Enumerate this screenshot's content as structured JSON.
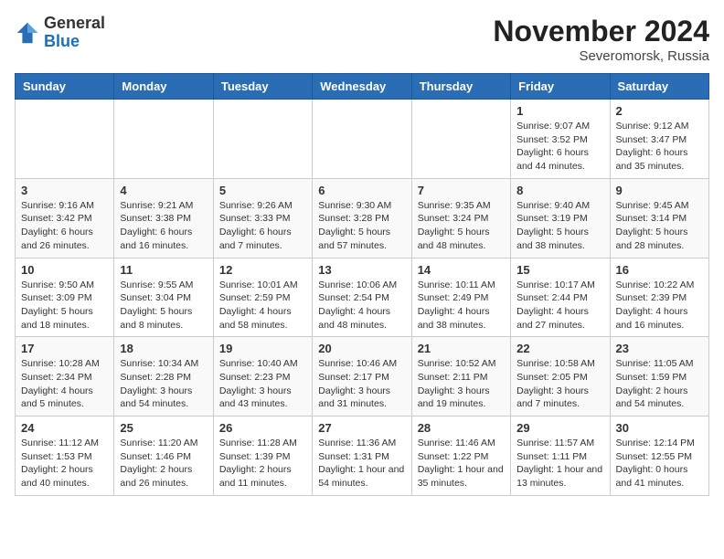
{
  "header": {
    "logo_line1": "General",
    "logo_line2": "Blue",
    "month_title": "November 2024",
    "subtitle": "Severomorsk, Russia"
  },
  "columns": [
    "Sunday",
    "Monday",
    "Tuesday",
    "Wednesday",
    "Thursday",
    "Friday",
    "Saturday"
  ],
  "weeks": [
    [
      {
        "day": "",
        "info": ""
      },
      {
        "day": "",
        "info": ""
      },
      {
        "day": "",
        "info": ""
      },
      {
        "day": "",
        "info": ""
      },
      {
        "day": "",
        "info": ""
      },
      {
        "day": "1",
        "info": "Sunrise: 9:07 AM\nSunset: 3:52 PM\nDaylight: 6 hours and 44 minutes."
      },
      {
        "day": "2",
        "info": "Sunrise: 9:12 AM\nSunset: 3:47 PM\nDaylight: 6 hours and 35 minutes."
      }
    ],
    [
      {
        "day": "3",
        "info": "Sunrise: 9:16 AM\nSunset: 3:42 PM\nDaylight: 6 hours and 26 minutes."
      },
      {
        "day": "4",
        "info": "Sunrise: 9:21 AM\nSunset: 3:38 PM\nDaylight: 6 hours and 16 minutes."
      },
      {
        "day": "5",
        "info": "Sunrise: 9:26 AM\nSunset: 3:33 PM\nDaylight: 6 hours and 7 minutes."
      },
      {
        "day": "6",
        "info": "Sunrise: 9:30 AM\nSunset: 3:28 PM\nDaylight: 5 hours and 57 minutes."
      },
      {
        "day": "7",
        "info": "Sunrise: 9:35 AM\nSunset: 3:24 PM\nDaylight: 5 hours and 48 minutes."
      },
      {
        "day": "8",
        "info": "Sunrise: 9:40 AM\nSunset: 3:19 PM\nDaylight: 5 hours and 38 minutes."
      },
      {
        "day": "9",
        "info": "Sunrise: 9:45 AM\nSunset: 3:14 PM\nDaylight: 5 hours and 28 minutes."
      }
    ],
    [
      {
        "day": "10",
        "info": "Sunrise: 9:50 AM\nSunset: 3:09 PM\nDaylight: 5 hours and 18 minutes."
      },
      {
        "day": "11",
        "info": "Sunrise: 9:55 AM\nSunset: 3:04 PM\nDaylight: 5 hours and 8 minutes."
      },
      {
        "day": "12",
        "info": "Sunrise: 10:01 AM\nSunset: 2:59 PM\nDaylight: 4 hours and 58 minutes."
      },
      {
        "day": "13",
        "info": "Sunrise: 10:06 AM\nSunset: 2:54 PM\nDaylight: 4 hours and 48 minutes."
      },
      {
        "day": "14",
        "info": "Sunrise: 10:11 AM\nSunset: 2:49 PM\nDaylight: 4 hours and 38 minutes."
      },
      {
        "day": "15",
        "info": "Sunrise: 10:17 AM\nSunset: 2:44 PM\nDaylight: 4 hours and 27 minutes."
      },
      {
        "day": "16",
        "info": "Sunrise: 10:22 AM\nSunset: 2:39 PM\nDaylight: 4 hours and 16 minutes."
      }
    ],
    [
      {
        "day": "17",
        "info": "Sunrise: 10:28 AM\nSunset: 2:34 PM\nDaylight: 4 hours and 5 minutes."
      },
      {
        "day": "18",
        "info": "Sunrise: 10:34 AM\nSunset: 2:28 PM\nDaylight: 3 hours and 54 minutes."
      },
      {
        "day": "19",
        "info": "Sunrise: 10:40 AM\nSunset: 2:23 PM\nDaylight: 3 hours and 43 minutes."
      },
      {
        "day": "20",
        "info": "Sunrise: 10:46 AM\nSunset: 2:17 PM\nDaylight: 3 hours and 31 minutes."
      },
      {
        "day": "21",
        "info": "Sunrise: 10:52 AM\nSunset: 2:11 PM\nDaylight: 3 hours and 19 minutes."
      },
      {
        "day": "22",
        "info": "Sunrise: 10:58 AM\nSunset: 2:05 PM\nDaylight: 3 hours and 7 minutes."
      },
      {
        "day": "23",
        "info": "Sunrise: 11:05 AM\nSunset: 1:59 PM\nDaylight: 2 hours and 54 minutes."
      }
    ],
    [
      {
        "day": "24",
        "info": "Sunrise: 11:12 AM\nSunset: 1:53 PM\nDaylight: 2 hours and 40 minutes."
      },
      {
        "day": "25",
        "info": "Sunrise: 11:20 AM\nSunset: 1:46 PM\nDaylight: 2 hours and 26 minutes."
      },
      {
        "day": "26",
        "info": "Sunrise: 11:28 AM\nSunset: 1:39 PM\nDaylight: 2 hours and 11 minutes."
      },
      {
        "day": "27",
        "info": "Sunrise: 11:36 AM\nSunset: 1:31 PM\nDaylight: 1 hour and 54 minutes."
      },
      {
        "day": "28",
        "info": "Sunrise: 11:46 AM\nSunset: 1:22 PM\nDaylight: 1 hour and 35 minutes."
      },
      {
        "day": "29",
        "info": "Sunrise: 11:57 AM\nSunset: 1:11 PM\nDaylight: 1 hour and 13 minutes."
      },
      {
        "day": "30",
        "info": "Sunrise: 12:14 PM\nSunset: 12:55 PM\nDaylight: 0 hours and 41 minutes."
      }
    ]
  ]
}
